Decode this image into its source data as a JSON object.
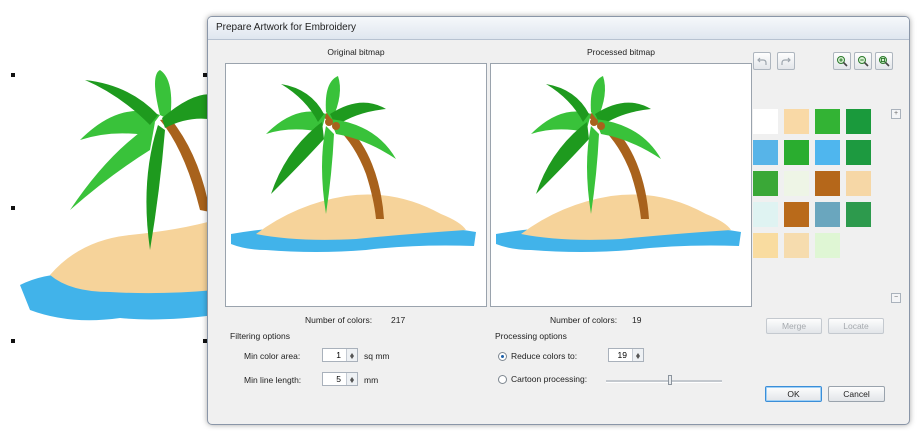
{
  "dialog": {
    "title": "Prepare Artwork for Embroidery",
    "original_title": "Original bitmap",
    "processed_title": "Processed bitmap",
    "original_colors_label": "Number of colors:",
    "original_colors_value": "217",
    "processed_colors_label": "Number of colors:",
    "processed_colors_value": "19"
  },
  "filtering": {
    "heading": "Filtering options",
    "min_area_label": "Min color area:",
    "min_area_value": "1",
    "min_area_unit": "sq mm",
    "min_line_label": "Min line length:",
    "min_line_value": "5",
    "min_line_unit": "mm"
  },
  "processing": {
    "heading": "Processing options",
    "reduce_label": "Reduce colors to:",
    "reduce_value": "19",
    "reduce_selected": true,
    "cartoon_label": "Cartoon processing:",
    "cartoon_selected": false
  },
  "palette": {
    "merge_label": "Merge",
    "locate_label": "Locate",
    "colors": [
      "#ffffff",
      "#f9d9a6",
      "#33b334",
      "#1a9a3c",
      "#57b4e8",
      "#2aad2f",
      "#4fb6ee",
      "#1d9a40",
      "#3aa837",
      "#eef5e6",
      "#b5671a",
      "#f6d7a6",
      "#dff3f2",
      "#b96a1a",
      "#6aa6be",
      "#2d9a4d",
      "#f9dca0",
      "#f6dcae",
      "#dff6d4"
    ]
  },
  "buttons": {
    "ok": "OK",
    "cancel": "Cancel"
  },
  "icons": {
    "undo": "undo-icon",
    "redo": "redo-icon",
    "zoom_in": "zoom-in-icon",
    "zoom_out": "zoom-out-icon",
    "zoom_fit": "zoom-fit-icon"
  },
  "art_colors": {
    "leaf_dark": "#1e9a1e",
    "leaf_light": "#39c23a",
    "trunk": "#a8621c",
    "sand": "#f6d39a",
    "water": "#41b3ea"
  }
}
